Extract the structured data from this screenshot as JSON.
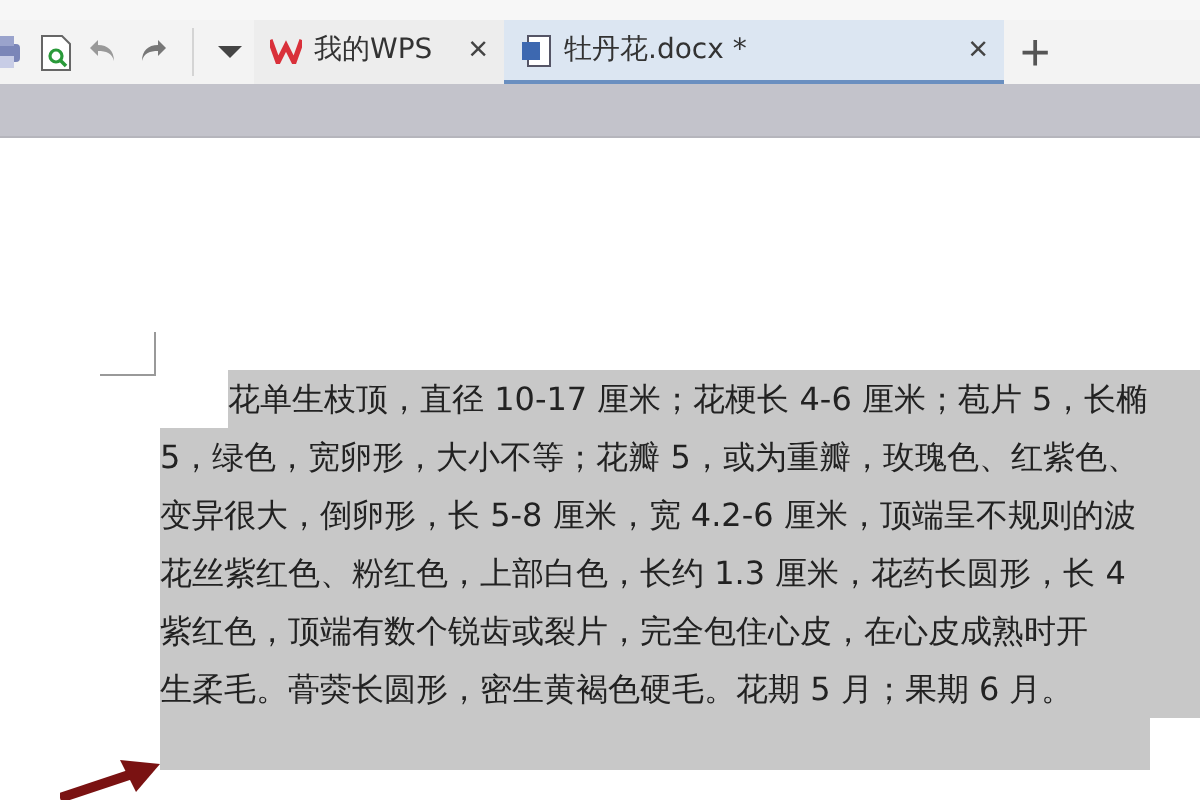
{
  "tabs": [
    {
      "label": "我的WPS",
      "kind": "home",
      "selected": false,
      "close": "×"
    },
    {
      "label": "牡丹花.docx *",
      "kind": "doc",
      "selected": true,
      "close": "×"
    }
  ],
  "new_tab": "+",
  "document": {
    "lines": [
      {
        "text": "花单生枝顶，直径 10-17 厘米；花梗长 4-6 厘米；苞片 5，长椭",
        "indent": true,
        "selected": true
      },
      {
        "text": "5，绿色，宽卵形，大小不等；花瓣 5，或为重瓣，玫瑰色、红紫色、",
        "indent": false,
        "selected": true
      },
      {
        "text": "变异很大，倒卵形，长 5-8 厘米，宽 4.2-6 厘米，顶端呈不规则的波",
        "indent": false,
        "selected": true
      },
      {
        "text": "花丝紫红色、粉红色，上部白色，长约 1.3 厘米，花药长圆形，长 4",
        "indent": false,
        "selected": true
      },
      {
        "text": "紫红色，顶端有数个锐齿或裂片，完全包住心皮，在心皮成熟时开",
        "indent": false,
        "selected": true
      },
      {
        "text": "生柔毛。蓇葖长圆形，密生黄褐色硬毛。花期 5 月；果期 6 月。",
        "indent": false,
        "selected": true
      }
    ]
  }
}
